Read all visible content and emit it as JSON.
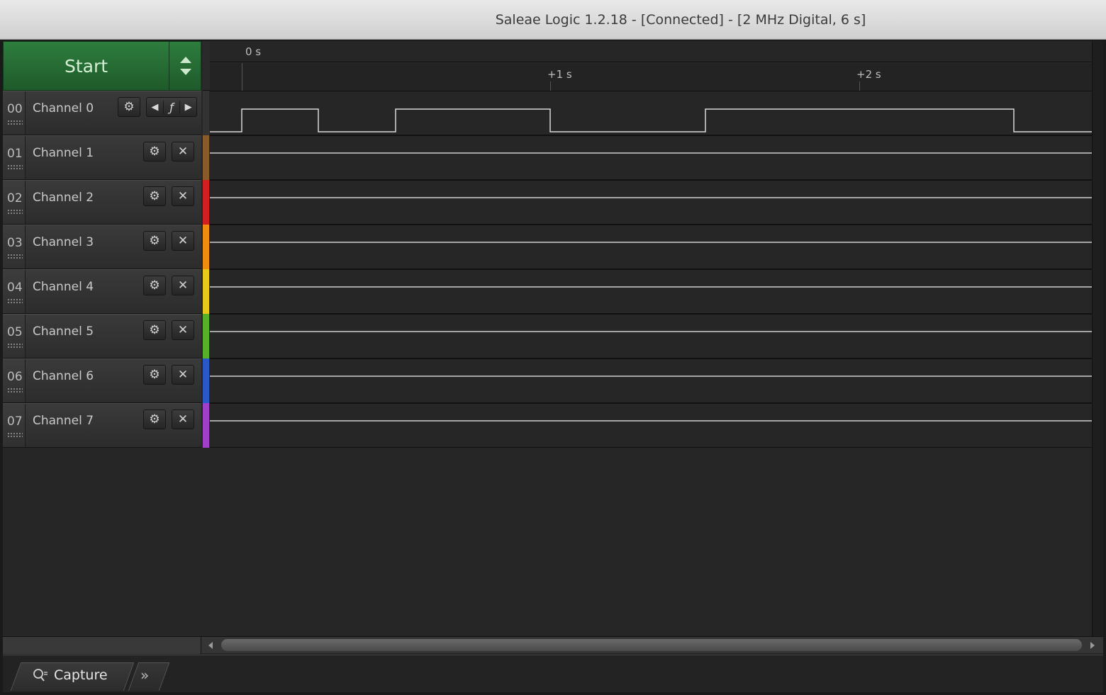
{
  "window": {
    "title": "Saleae Logic 1.2.18 - [Connected] - [2 MHz Digital, 6 s]"
  },
  "start": {
    "label": "Start"
  },
  "timeline": {
    "zero_label": "0 s",
    "ticks": [
      "+1 s",
      "+2 s"
    ]
  },
  "channels": [
    {
      "num": "00",
      "name": "Channel 0",
      "color": "#3a3a3a"
    },
    {
      "num": "01",
      "name": "Channel 1",
      "color": "#8b5a2b"
    },
    {
      "num": "02",
      "name": "Channel 2",
      "color": "#d22020"
    },
    {
      "num": "03",
      "name": "Channel 3",
      "color": "#f08c10"
    },
    {
      "num": "04",
      "name": "Channel 4",
      "color": "#e8c818"
    },
    {
      "num": "05",
      "name": "Channel 5",
      "color": "#58b028"
    },
    {
      "num": "06",
      "name": "Channel 6",
      "color": "#2a58c8"
    },
    {
      "num": "07",
      "name": "Channel 7",
      "color": "#a040c8"
    }
  ],
  "icons": {
    "settings": "gear-icon",
    "remove": "close-icon",
    "trigger": "rising-edge-icon"
  },
  "bottom": {
    "capture_label": "Capture",
    "more_icon": "double-chevron-right-icon"
  }
}
